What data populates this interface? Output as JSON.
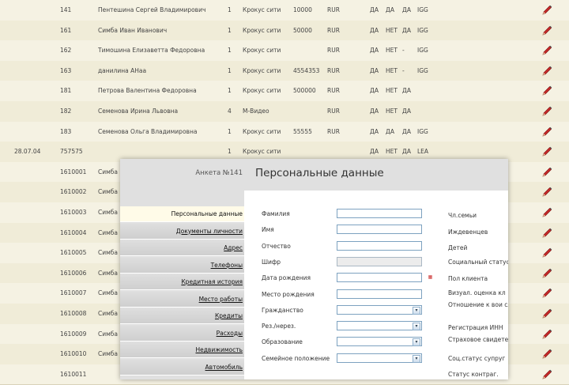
{
  "table_rows": [
    {
      "date": "",
      "id": "141",
      "name": "Пентешина  Сергей Владимирович",
      "n": "1",
      "store": "Крокус сити",
      "sum": "10000",
      "cur": "RUR",
      "f1": "ДА",
      "f2": "ДА",
      "f3": "ДА",
      "f4": "IGG"
    },
    {
      "date": "",
      "id": "161",
      "name": "Симба Иван Иванович",
      "n": "1",
      "store": "Крокус сити",
      "sum": "50000",
      "cur": "RUR",
      "f1": "ДА",
      "f2": "НЕТ",
      "f3": "ДА",
      "f4": "IGG"
    },
    {
      "date": "",
      "id": "162",
      "name": "Тимошина Елизаветта Федоровна",
      "n": "1",
      "store": "Крокус сити",
      "sum": "",
      "cur": "RUR",
      "f1": "ДА",
      "f2": "НЕТ",
      "f3": "-",
      "f4": "IGG"
    },
    {
      "date": "",
      "id": "163",
      "name": "данилина АНаа",
      "n": "1",
      "store": "Крокус сити",
      "sum": "4554353",
      "cur": "RUR",
      "f1": "ДА",
      "f2": "НЕТ",
      "f3": "-",
      "f4": "IGG"
    },
    {
      "date": "",
      "id": "181",
      "name": "Петрова Валентина Федоровна",
      "n": "1",
      "store": "Крокус сити",
      "sum": "500000",
      "cur": "RUR",
      "f1": "ДА",
      "f2": "НЕТ",
      "f3": "ДА",
      "f4": ""
    },
    {
      "date": "",
      "id": "182",
      "name": "Семенова Ирина Львовна",
      "n": "4",
      "store": "М-Видео",
      "sum": "",
      "cur": "RUR",
      "f1": "ДА",
      "f2": "НЕТ",
      "f3": "ДА",
      "f4": ""
    },
    {
      "date": "",
      "id": "183",
      "name": "Семенова Ольга Владимировна",
      "n": "1",
      "store": "Крокус сити",
      "sum": "55555",
      "cur": "RUR",
      "f1": "ДА",
      "f2": "ДА",
      "f3": "ДА",
      "f4": "IGG"
    },
    {
      "date": "28.07.04",
      "id": "757575",
      "name": "",
      "n": "1",
      "store": "Крокус сити",
      "sum": "",
      "cur": "",
      "f1": "ДА",
      "f2": "НЕТ",
      "f3": "ДА",
      "f4": "LEA"
    },
    {
      "date": "",
      "id": "1610001",
      "name": "Симба",
      "n": "",
      "store": "",
      "sum": "",
      "cur": "",
      "f1": "",
      "f2": "",
      "f3": "",
      "f4": ""
    },
    {
      "date": "",
      "id": "1610002",
      "name": "Симба",
      "n": "",
      "store": "",
      "sum": "",
      "cur": "",
      "f1": "",
      "f2": "",
      "f3": "",
      "f4": ""
    },
    {
      "date": "",
      "id": "1610003",
      "name": "Симба",
      "n": "",
      "store": "",
      "sum": "",
      "cur": "",
      "f1": "",
      "f2": "",
      "f3": "",
      "f4": ""
    },
    {
      "date": "",
      "id": "1610004",
      "name": "Симба",
      "n": "",
      "store": "",
      "sum": "",
      "cur": "",
      "f1": "",
      "f2": "",
      "f3": "",
      "f4": ""
    },
    {
      "date": "",
      "id": "1610005",
      "name": "Симба",
      "n": "",
      "store": "",
      "sum": "",
      "cur": "",
      "f1": "",
      "f2": "",
      "f3": "",
      "f4": ""
    },
    {
      "date": "",
      "id": "1610006",
      "name": "Симба",
      "n": "",
      "store": "",
      "sum": "",
      "cur": "",
      "f1": "",
      "f2": "",
      "f3": "",
      "f4": ""
    },
    {
      "date": "",
      "id": "1610007",
      "name": "Симба",
      "n": "",
      "store": "",
      "sum": "",
      "cur": "",
      "f1": "",
      "f2": "",
      "f3": "",
      "f4": ""
    },
    {
      "date": "",
      "id": "1610008",
      "name": "Симба",
      "n": "",
      "store": "",
      "sum": "",
      "cur": "",
      "f1": "",
      "f2": "",
      "f3": "",
      "f4": ""
    },
    {
      "date": "",
      "id": "1610009",
      "name": "Симба",
      "n": "",
      "store": "",
      "sum": "",
      "cur": "",
      "f1": "",
      "f2": "",
      "f3": "",
      "f4": ""
    },
    {
      "date": "",
      "id": "1610010",
      "name": "Симба",
      "n": "",
      "store": "",
      "sum": "",
      "cur": "",
      "f1": "",
      "f2": "",
      "f3": "",
      "f4": ""
    },
    {
      "date": "",
      "id": "1610011",
      "name": "",
      "n": "",
      "store": "",
      "sum": "",
      "cur": "",
      "f1": "",
      "f2": "",
      "f3": "",
      "f4": ""
    }
  ],
  "modal": {
    "anketa": "Анкета №141",
    "title": "Персональные данные",
    "nav": [
      "Персональные данные",
      "Документы личности",
      "Адрес",
      "Телефоны",
      "Кредитная история",
      "Место работы",
      "Кредиты",
      "Расходы",
      "Недвижимость",
      "Автомобиль"
    ],
    "fields": [
      {
        "label": "Фамилия",
        "type": "text",
        "value": ""
      },
      {
        "label": "Имя",
        "type": "text",
        "value": ""
      },
      {
        "label": "Отчество",
        "type": "text",
        "value": ""
      },
      {
        "label": "Шифр",
        "type": "readonly",
        "value": ""
      },
      {
        "label": "Дата рождения",
        "type": "date",
        "value": ""
      },
      {
        "label": "Место рождения",
        "type": "text",
        "value": ""
      },
      {
        "label": "Гражданство",
        "type": "select",
        "value": ""
      },
      {
        "label": "Рез./нерез.",
        "type": "select",
        "value": ""
      },
      {
        "label": "Образование",
        "type": "select",
        "value": ""
      },
      {
        "label": "Семейное положение",
        "type": "select",
        "value": ""
      }
    ],
    "right_labels": [
      "Чл.семьи",
      "Иждевенцев",
      "Детей",
      "Социальный статус",
      "Пол клиента",
      "Визуал. оценка кл",
      "Отношение к вои служб",
      "Регистрация ИНН",
      "Страховое свидете ПФ",
      "Соц.статус супруг",
      "Статус контраг."
    ]
  },
  "icons": {
    "edit": "pencil-icon",
    "calendar": "calendar-icon",
    "dropdown": "dropdown-arrow-icon"
  },
  "colors": {
    "row_bg": "#f5f2e3",
    "modal_header": "#e0e0e0",
    "input_border": "#7da2c0",
    "pencil": "#c62828"
  }
}
